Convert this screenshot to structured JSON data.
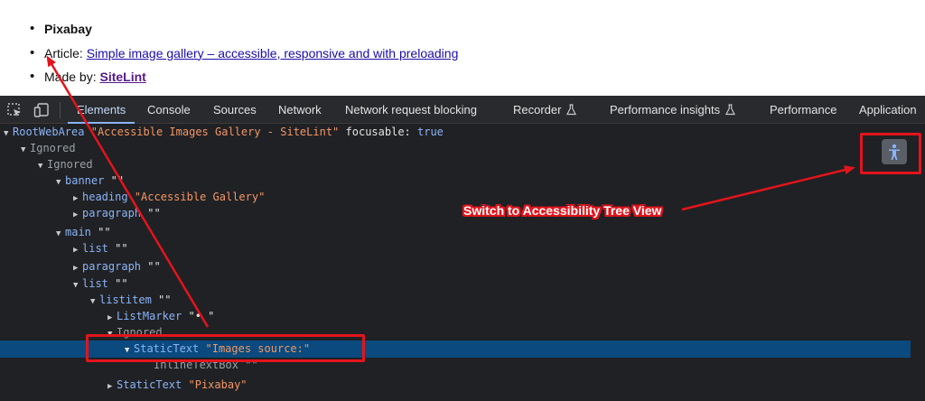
{
  "webpage": {
    "items": [
      {
        "text": "Pixabay"
      },
      {
        "label": "Article: ",
        "link": "Simple image gallery – accessible, responsive and with preloading"
      },
      {
        "label": "Made by: ",
        "link": "SiteLint"
      }
    ]
  },
  "devtools": {
    "tabs": [
      "Elements",
      "Console",
      "Sources",
      "Network",
      "Network request blocking",
      "Recorder",
      "Performance insights",
      "Performance",
      "Application"
    ],
    "active_tab": "Elements",
    "tree": [
      {
        "role": "RootWebArea",
        "name": "Accessible Images Gallery - SiteLint",
        "prop": "focusable",
        "val": "true"
      },
      {
        "role": "Ignored"
      },
      {
        "role": "Ignored"
      },
      {
        "role": "banner",
        "name": ""
      },
      {
        "role": "heading",
        "name": "Accessible Gallery"
      },
      {
        "role": "paragraph",
        "name": ""
      },
      {
        "role": "main",
        "name": ""
      },
      {
        "role": "list",
        "name": ""
      },
      {
        "role": "paragraph",
        "name": ""
      },
      {
        "role": "list",
        "name": ""
      },
      {
        "role": "listitem",
        "name": ""
      },
      {
        "role": "ListMarker",
        "name": "• "
      },
      {
        "role": "Ignored"
      },
      {
        "role": "StaticText",
        "name": "Images source:"
      },
      {
        "role": "InlineTextBox",
        "name": ""
      },
      {
        "role": "StaticText",
        "name": "Pixabay"
      }
    ]
  },
  "annotation": {
    "callout": "Switch to Accessibility Tree View",
    "color": "#e3141c"
  },
  "colors": {
    "devtools_bg": "#202124",
    "toolbar_bg": "#292a2d",
    "role": "#8ab4f8",
    "name": "#f29766",
    "selection": "#0a4a7e"
  }
}
